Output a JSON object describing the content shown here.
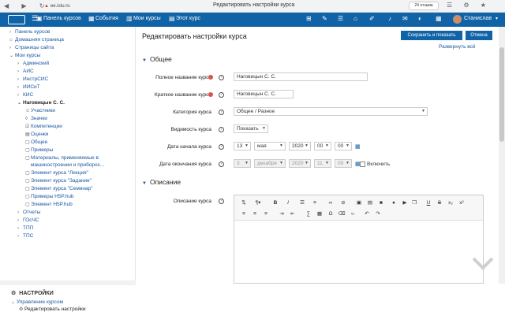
{
  "browser": {
    "url": "ee.istu.ru",
    "tab_title": "Редактировать настройки курса",
    "rating_badge": "24 отзыва"
  },
  "navbar": {
    "items": [
      "Панель курсов",
      "События",
      "Мои курсы",
      "Этот курс"
    ],
    "username": "Станислав"
  },
  "sidebar": {
    "items": [
      "Панель курсов",
      "Домашняя страница",
      "Страницы сайта",
      "Мои курсы",
      "Админский",
      "АИС",
      "ИнстрСИС",
      "ИИСиТ",
      "КИС",
      "Наговицын С. С.",
      "Участники",
      "Значки",
      "Компетенции",
      "Оценки",
      "Общее",
      "Примеры",
      "Материалы, применяемые в",
      "машиностроении и приборос...",
      "Элемент курса \"Лекция\"",
      "Элемент курса \"Задание\"",
      "Элемент курса \"Семинар\"",
      "Примеры H5P.hub",
      "Элемент H5P.hub",
      "Отчеты",
      "ГОсЧС",
      "ТПП",
      "ТПС"
    ],
    "settings_title": "НАСТРОЙКИ",
    "settings_items": [
      "Управление курсом",
      "Редактировать настройки"
    ]
  },
  "main": {
    "title": "Редактировать настройки курса",
    "save_label": "Сохранить и показать",
    "cancel_label": "Отмена",
    "expand_all": "Развернуть всё",
    "section_general": "Общее",
    "section_description": "Описание",
    "fields": {
      "fullname_label": "Полное название курса",
      "fullname_value": "Наговицын С. С.",
      "shortname_label": "Краткое название курса",
      "shortname_value": "Наговицын С. С.",
      "category_label": "Категория курса",
      "category_value": "Общее / Разное",
      "visibility_label": "Видимость курса",
      "visibility_value": "Показать",
      "startdate_label": "Дата начала курса",
      "start_day": "13",
      "start_month": "мая",
      "start_year": "2020",
      "start_hour": "00",
      "start_min": "00",
      "enddate_label": "Дата окончания курса",
      "end_day": "3",
      "end_month": "декабря",
      "end_year": "2020",
      "end_hour": "11",
      "end_min": "00",
      "enable_label": "Включить",
      "description_label": "Описание курса"
    }
  },
  "colors": {
    "navbar": "#1163a7",
    "link": "#1a57a1",
    "required": "#d9534f"
  }
}
